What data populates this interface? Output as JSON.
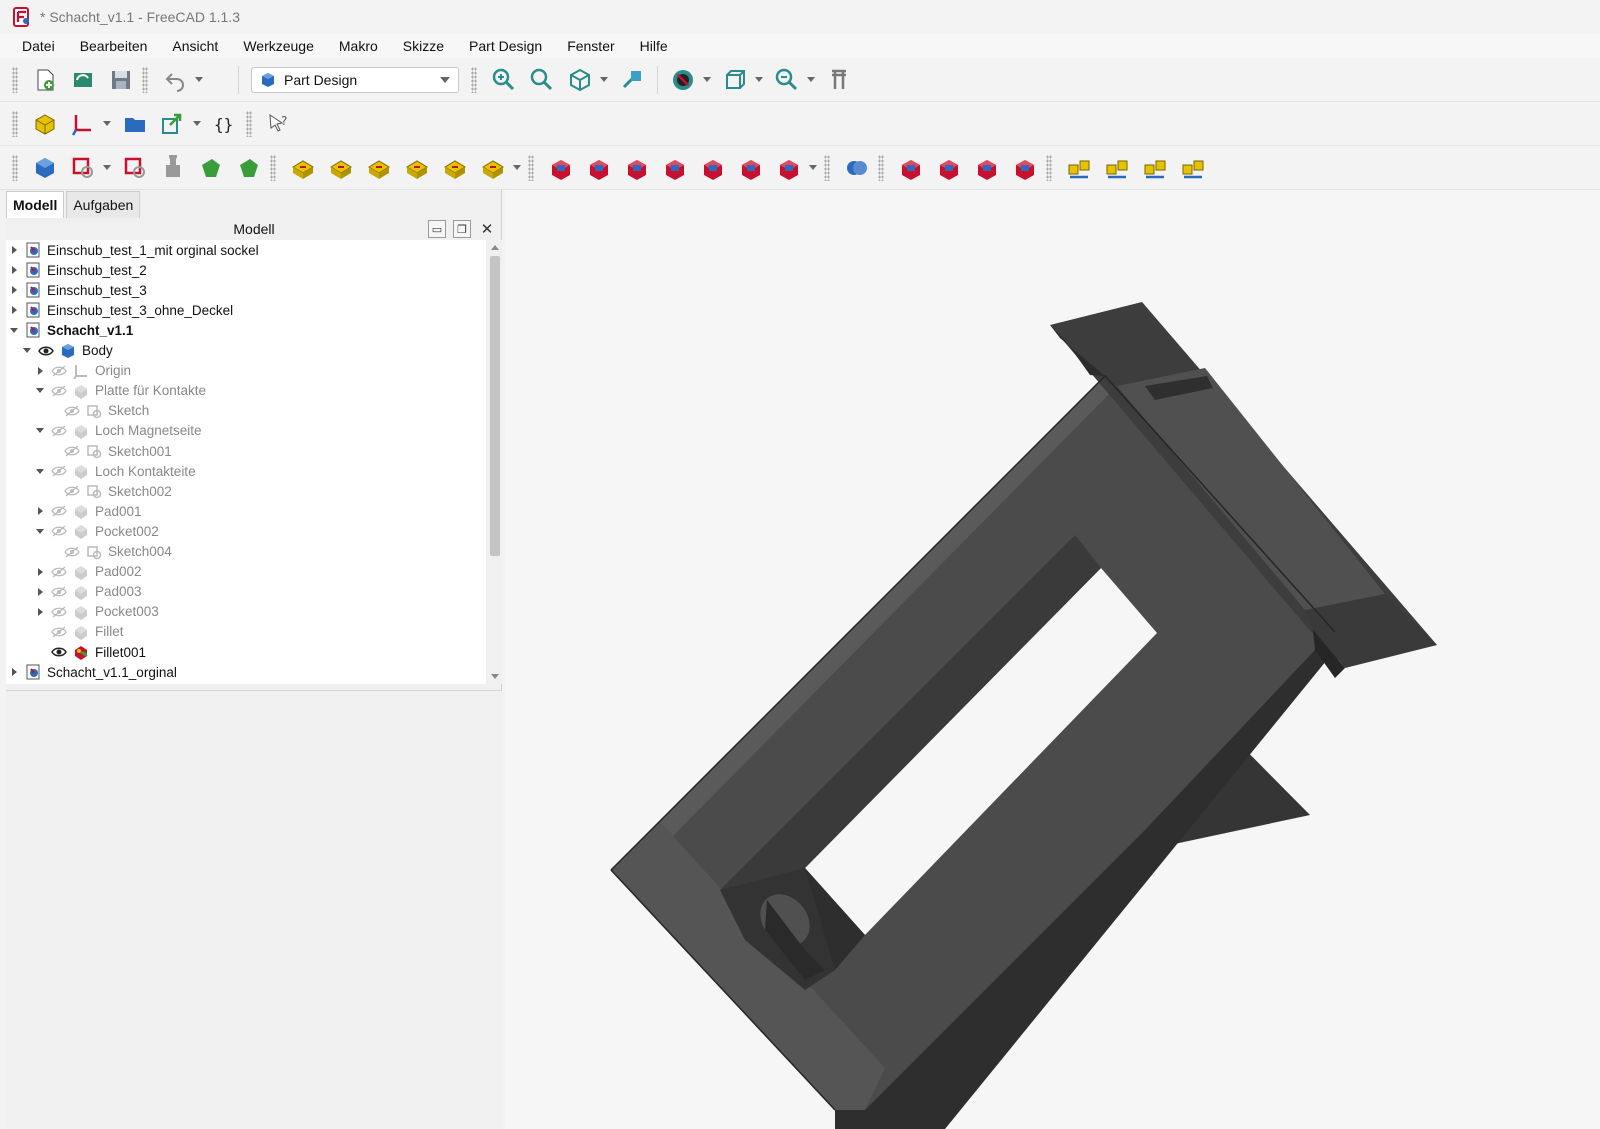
{
  "window": {
    "title": "* Schacht_v1.1 - FreeCAD 1.1.3"
  },
  "menu": [
    {
      "label": "Datei"
    },
    {
      "label": "Bearbeiten"
    },
    {
      "label": "Ansicht"
    },
    {
      "label": "Werkzeuge"
    },
    {
      "label": "Makro"
    },
    {
      "label": "Skizze"
    },
    {
      "label": "Part Design"
    },
    {
      "label": "Fenster"
    },
    {
      "label": "Hilfe"
    }
  ],
  "toolbar": {
    "workbench": "Part Design",
    "row1_icons": [
      "new-document-icon",
      "open-document-icon",
      "save-icon",
      "undo-icon",
      "fit-all-icon",
      "fit-selection-icon",
      "isometric-view-icon",
      "align-view-icon",
      "draw-style-icon",
      "bounding-box-icon",
      "zoom-icon",
      "measure-icon"
    ],
    "row2_icons": [
      "part-icon",
      "create-datum-icon",
      "group-icon",
      "link-icon",
      "variable-set-icon",
      "whats-this-icon"
    ],
    "row3_icons": [
      "body-icon",
      "sketch-icon",
      "validate-sketch-icon",
      "clone-icon",
      "shape-binder-icon",
      "subshape-binder-icon",
      "pad-icon",
      "revolution-icon",
      "loft-icon",
      "pipe-icon",
      "helix-icon",
      "additive-primitive-icon",
      "pocket-icon",
      "hole-icon",
      "groove-icon",
      "subtractive-loft-icon",
      "subtractive-pipe-icon",
      "subtractive-helix-icon",
      "subtractive-primitive-icon",
      "boolean-icon",
      "fillet-icon",
      "chamfer-icon",
      "draft-icon",
      "thickness-icon",
      "mirrored-icon",
      "linear-pattern-icon",
      "polar-pattern-icon",
      "multitransform-icon"
    ]
  },
  "panel": {
    "tabs": [
      {
        "label": "Modell"
      },
      {
        "label": "Aufgaben"
      }
    ],
    "header": "Modell",
    "tree": [
      {
        "label": "Einschub_test_1_mit orginal sockel",
        "level": 0,
        "arrow": "right",
        "eye": false,
        "icon": "doc",
        "style": "normal"
      },
      {
        "label": "Einschub_test_2",
        "level": 0,
        "arrow": "right",
        "eye": false,
        "icon": "doc",
        "style": "normal"
      },
      {
        "label": "Einschub_test_3",
        "level": 0,
        "arrow": "right",
        "eye": false,
        "icon": "doc",
        "style": "normal"
      },
      {
        "label": "Einschub_test_3_ohne_Deckel",
        "level": 0,
        "arrow": "right",
        "eye": false,
        "icon": "doc",
        "style": "normal"
      },
      {
        "label": "Schacht_v1.1",
        "level": 0,
        "arrow": "down",
        "eye": false,
        "icon": "doc",
        "style": "bold"
      },
      {
        "label": "Body",
        "level": 1,
        "arrow": "down",
        "eye": "visible",
        "icon": "body",
        "style": "normal"
      },
      {
        "label": "Origin",
        "level": 2,
        "arrow": "right",
        "eye": "hidden",
        "icon": "origin",
        "style": "dim"
      },
      {
        "label": "Platte für Kontakte",
        "level": 2,
        "arrow": "down",
        "eye": "hidden",
        "icon": "feature",
        "style": "dim"
      },
      {
        "label": "Sketch",
        "level": 3,
        "arrow": "none",
        "eye": "hidden",
        "icon": "sketch",
        "style": "dim"
      },
      {
        "label": "Loch Magnetseite",
        "level": 2,
        "arrow": "down",
        "eye": "hidden",
        "icon": "feature",
        "style": "dim"
      },
      {
        "label": "Sketch001",
        "level": 3,
        "arrow": "none",
        "eye": "hidden",
        "icon": "sketch",
        "style": "dim"
      },
      {
        "label": "Loch Kontakteite",
        "level": 2,
        "arrow": "down",
        "eye": "hidden",
        "icon": "feature",
        "style": "dim"
      },
      {
        "label": "Sketch002",
        "level": 3,
        "arrow": "none",
        "eye": "hidden",
        "icon": "sketch",
        "style": "dim"
      },
      {
        "label": "Pad001",
        "level": 2,
        "arrow": "right",
        "eye": "hidden",
        "icon": "feature",
        "style": "dim"
      },
      {
        "label": "Pocket002",
        "level": 2,
        "arrow": "down",
        "eye": "hidden",
        "icon": "feature",
        "style": "dim"
      },
      {
        "label": "Sketch004",
        "level": 3,
        "arrow": "none",
        "eye": "hidden",
        "icon": "sketch",
        "style": "dim"
      },
      {
        "label": "Pad002",
        "level": 2,
        "arrow": "right",
        "eye": "hidden",
        "icon": "feature",
        "style": "dim"
      },
      {
        "label": "Pad003",
        "level": 2,
        "arrow": "right",
        "eye": "hidden",
        "icon": "feature",
        "style": "dim"
      },
      {
        "label": "Pocket003",
        "level": 2,
        "arrow": "right",
        "eye": "hidden",
        "icon": "feature",
        "style": "dim"
      },
      {
        "label": "Fillet",
        "level": 2,
        "arrow": "none",
        "eye": "hidden",
        "icon": "feature",
        "style": "dim"
      },
      {
        "label": "Fillet001",
        "level": 2,
        "arrow": "none",
        "eye": "visible",
        "icon": "fillet",
        "style": "normal"
      },
      {
        "label": "Schacht_v1.1_orginal",
        "level": 0,
        "arrow": "right",
        "eye": false,
        "icon": "doc",
        "style": "normal"
      }
    ]
  },
  "colors": {
    "model_face": "#4c4c4c",
    "model_dark": "#333333",
    "model_light": "#5a5a5a",
    "viewport_bg": "#f6f6f6",
    "icon_blue": "#2a6bbf",
    "icon_red": "#c8102e",
    "icon_yellow": "#e6c200"
  }
}
